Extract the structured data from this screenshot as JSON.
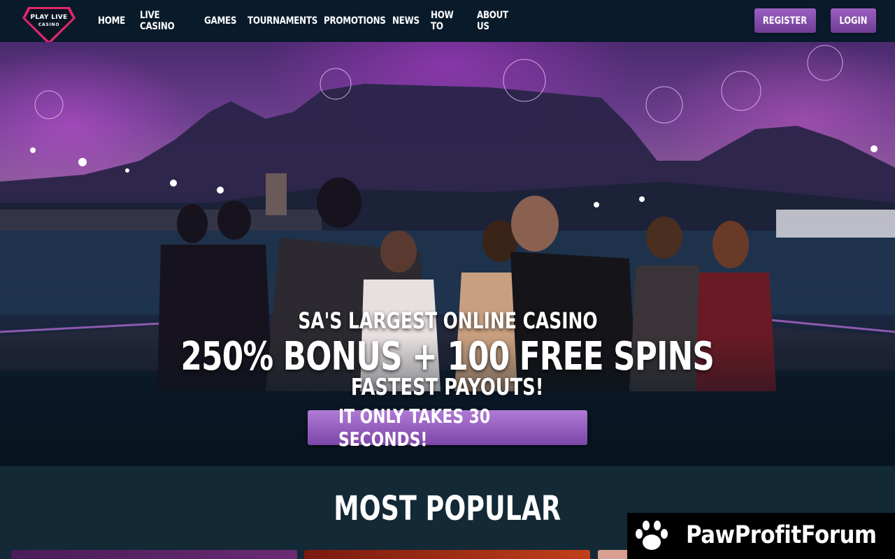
{
  "brand": {
    "logo_line1": "PLAY LIVE",
    "logo_line2": "CASINO"
  },
  "nav": {
    "items": [
      {
        "label": "HOME"
      },
      {
        "label": "LIVE CASINO"
      },
      {
        "label": "GAMES"
      },
      {
        "label": "TOURNAMENTS"
      },
      {
        "label": "PROMOTIONS"
      },
      {
        "label": "NEWS"
      },
      {
        "label": "HOW TO"
      },
      {
        "label": "ABOUT US"
      }
    ],
    "register_label": "REGISTER",
    "login_label": "LOGIN"
  },
  "hero": {
    "line1": "SA'S LARGEST ONLINE CASINO",
    "line2": "250% BONUS + 100 FREE SPINS",
    "line3": "FASTEST PAYOUTS!",
    "cta_label": "IT ONLY TAKES 30 SECONDS!"
  },
  "popular": {
    "title": "MOST POPULAR"
  },
  "watermark": {
    "text": "PawProfitForum",
    "icon": "paw-icon"
  },
  "colors": {
    "nav_bg": "#091a2a",
    "button_purple": "#8a52b4",
    "section_bg": "#132936"
  }
}
